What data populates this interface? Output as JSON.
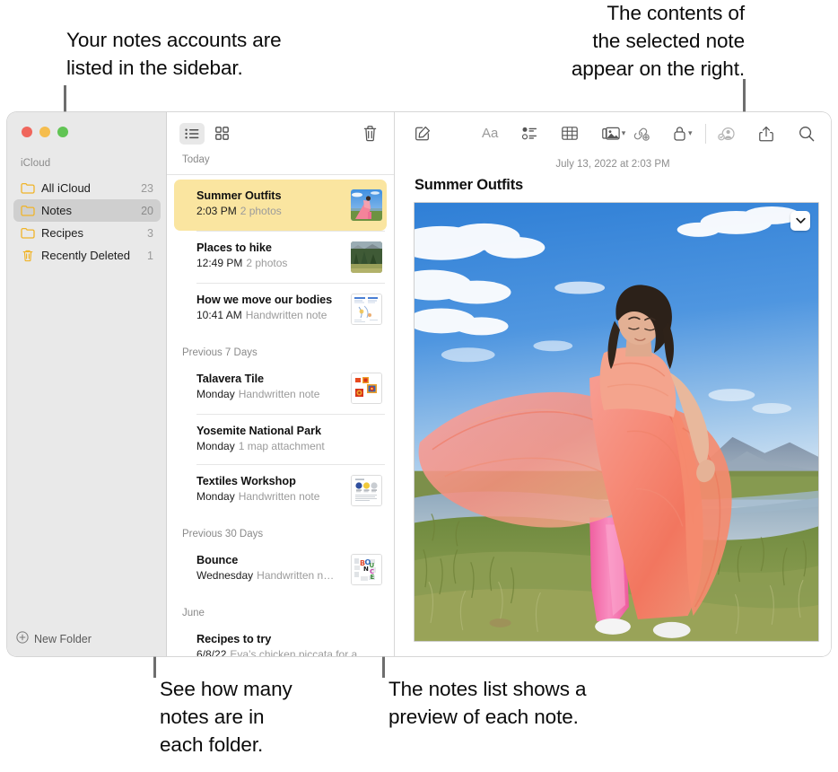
{
  "callouts": [
    {
      "id": "sidebar-accounts",
      "text": "Your notes accounts are\nlisted in the sidebar."
    },
    {
      "id": "note-contents",
      "text": "The contents of\nthe selected note\nappear on the right."
    },
    {
      "id": "folder-counts",
      "text": "See how many\nnotes are in\neach folder."
    },
    {
      "id": "note-preview",
      "text": "The notes list shows a\npreview of each note."
    }
  ],
  "window": {
    "traffic_lights": {
      "close_color": "#f0665c",
      "minimize_color": "#f5bd4e",
      "maximize_color": "#61c454"
    }
  },
  "sidebar": {
    "account_header": "iCloud",
    "folders": [
      {
        "icon": "folder-icon",
        "label": "All iCloud",
        "count": "23",
        "selected": false
      },
      {
        "icon": "folder-icon",
        "label": "Notes",
        "count": "20",
        "selected": true
      },
      {
        "icon": "folder-icon",
        "label": "Recipes",
        "count": "3",
        "selected": false
      },
      {
        "icon": "trash-icon",
        "label": "Recently Deleted",
        "count": "1",
        "selected": false
      }
    ],
    "new_folder_label": "New Folder",
    "new_folder_icon": "plus-circle-icon",
    "folder_icon_color": "#f0b429"
  },
  "notes_list": {
    "toolbar": {
      "list_view_icon": "list-view-icon",
      "gallery_view_icon": "gallery-view-icon",
      "delete_icon": "trash-icon",
      "active_view": "list"
    },
    "today_header": "Today",
    "groups": [
      {
        "header": "Today",
        "inline_header": true,
        "notes": [
          {
            "title": "Summer Outfits",
            "date": "2:03 PM",
            "snippet": "2 photos",
            "selected": true,
            "thumb": "photo-pink-dress",
            "framed": false
          },
          {
            "title": "Places to hike",
            "date": "12:49 PM",
            "snippet": "2 photos",
            "selected": false,
            "thumb": "photo-forest",
            "framed": false
          },
          {
            "title": "How we move our bodies",
            "date": "10:41 AM",
            "snippet": "Handwritten note",
            "selected": false,
            "thumb": "doc-handwritten-blue",
            "framed": true
          }
        ]
      },
      {
        "header": "Previous 7 Days",
        "inline_header": false,
        "notes": [
          {
            "title": "Talavera Tile",
            "date": "Monday",
            "snippet": "Handwritten note",
            "selected": false,
            "thumb": "doc-tiles",
            "framed": true
          },
          {
            "title": "Yosemite National Park",
            "date": "Monday",
            "snippet": "1 map attachment",
            "selected": false,
            "thumb": "none",
            "framed": false
          },
          {
            "title": "Textiles Workshop",
            "date": "Monday",
            "snippet": "Handwritten note",
            "selected": false,
            "thumb": "doc-textiles",
            "framed": true
          }
        ]
      },
      {
        "header": "Previous 30 Days",
        "inline_header": false,
        "notes": [
          {
            "title": "Bounce",
            "date": "Wednesday",
            "snippet": "Handwritten n…",
            "selected": false,
            "thumb": "doc-bounce",
            "framed": true
          }
        ]
      },
      {
        "header": "June",
        "inline_header": false,
        "notes": [
          {
            "title": "Recipes to try",
            "date": "6/8/22",
            "snippet": "Eva’s chicken piccata for a…",
            "selected": false,
            "thumb": "none",
            "framed": false
          }
        ]
      }
    ],
    "selected_row_color": "#fae5a0"
  },
  "detail": {
    "toolbar_icons": [
      {
        "name": "compose-icon",
        "label": "Compose"
      },
      {
        "name": "format-text-icon",
        "label": "Aa"
      },
      {
        "name": "checklist-icon",
        "label": "Checklist"
      },
      {
        "name": "table-icon",
        "label": "Table"
      },
      {
        "name": "media-icon",
        "label": "Media",
        "has_chevron": true
      },
      {
        "name": "link-add-icon",
        "label": "Add Link"
      },
      {
        "name": "lock-icon",
        "label": "Lock",
        "has_chevron": true
      },
      {
        "name": "collaborate-icon",
        "label": "Collaborate"
      },
      {
        "name": "share-icon",
        "label": "Share"
      },
      {
        "name": "search-icon",
        "label": "Search"
      }
    ],
    "timestamp": "July 13, 2022 at 2:03 PM",
    "title": "Summer Outfits",
    "photo_menu_icon": "chevron-down-icon",
    "photo_alt": "Woman in flowing pink and orange dress walking on grass beside a stream with mountains and blue sky"
  }
}
